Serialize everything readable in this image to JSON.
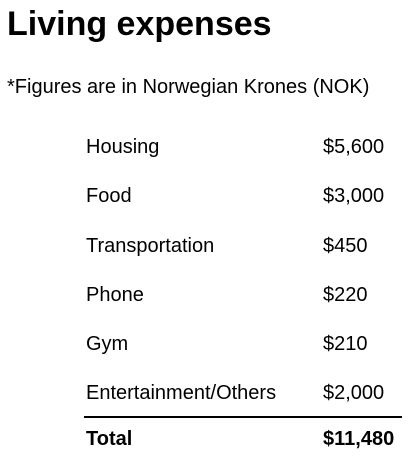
{
  "title": "Living expenses",
  "note": "*Figures are in Norwegian Krones (NOK)",
  "expenses": [
    {
      "label": "Housing",
      "amount": "$5,600"
    },
    {
      "label": "Food",
      "amount": "$3,000"
    },
    {
      "label": "Transportation",
      "amount": "$450"
    },
    {
      "label": "Phone",
      "amount": "$220"
    },
    {
      "label": "Gym",
      "amount": "$210"
    },
    {
      "label": "Entertainment/Others",
      "amount": "$2,000"
    }
  ],
  "total": {
    "label": "Total",
    "amount": "$11,480"
  }
}
